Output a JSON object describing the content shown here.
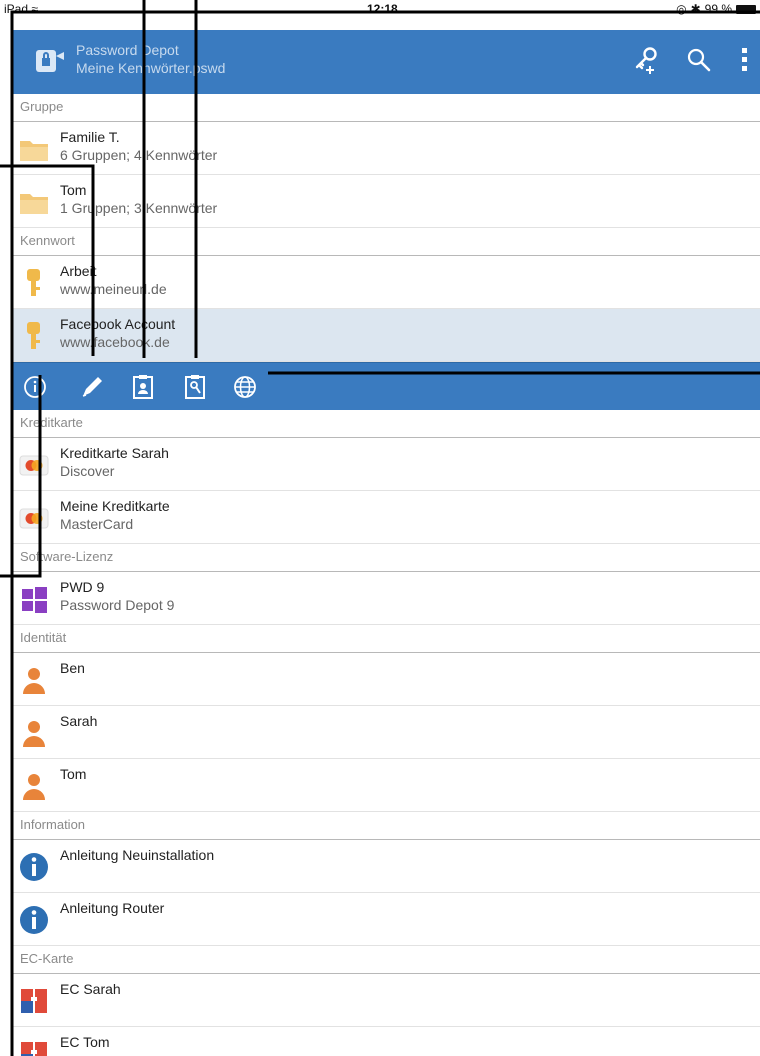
{
  "status": {
    "device": "iPad",
    "time": "12:18",
    "battery": "99 %"
  },
  "appbar": {
    "title": "Password Depot",
    "subtitle": "Meine Kennwörter.pswd",
    "icons": [
      "add-password-icon",
      "search-icon",
      "overflow-menu-icon"
    ]
  },
  "sections": {
    "group": "Gruppe",
    "password": "Kennwort",
    "creditcard": "Kreditkarte",
    "software": "Software-Lizenz",
    "identity": "Identität",
    "information": "Information",
    "eccard": "EC-Karte"
  },
  "groups": [
    {
      "name": "Familie T.",
      "detail": "6 Gruppen; 4 Kennwörter"
    },
    {
      "name": "Tom",
      "detail": "1 Gruppen; 3 Kennwörter"
    }
  ],
  "passwords": [
    {
      "name": "Arbeit",
      "detail": "www.meineurl.de"
    },
    {
      "name": "Facebook Account",
      "detail": "www.facebook.de"
    }
  ],
  "toolbar_icons": [
    "info-icon",
    "edit-pencil-icon",
    "copy-username-icon",
    "copy-password-icon",
    "open-url-globe-icon"
  ],
  "creditcards": [
    {
      "name": "Kreditkarte Sarah",
      "detail": "Discover"
    },
    {
      "name": "Meine Kreditkarte",
      "detail": "MasterCard"
    }
  ],
  "software": [
    {
      "name": "PWD 9",
      "detail": "Password Depot 9"
    }
  ],
  "identities": [
    {
      "name": "Ben"
    },
    {
      "name": "Sarah"
    },
    {
      "name": "Tom"
    }
  ],
  "information": [
    {
      "name": "Anleitung Neuinstallation"
    },
    {
      "name": "Anleitung Router"
    }
  ],
  "eccards": [
    {
      "name": "EC Sarah"
    },
    {
      "name": "EC Tom"
    }
  ],
  "colors": {
    "appbar": "#3a7bc0",
    "selected_row": "#dce6f0",
    "folder": "#f3c878",
    "key": "#f0b94a",
    "identity": "#e8843a",
    "info": "#2d6fb3",
    "ec_red": "#e04a3a",
    "ec_blue": "#2f5fae"
  }
}
